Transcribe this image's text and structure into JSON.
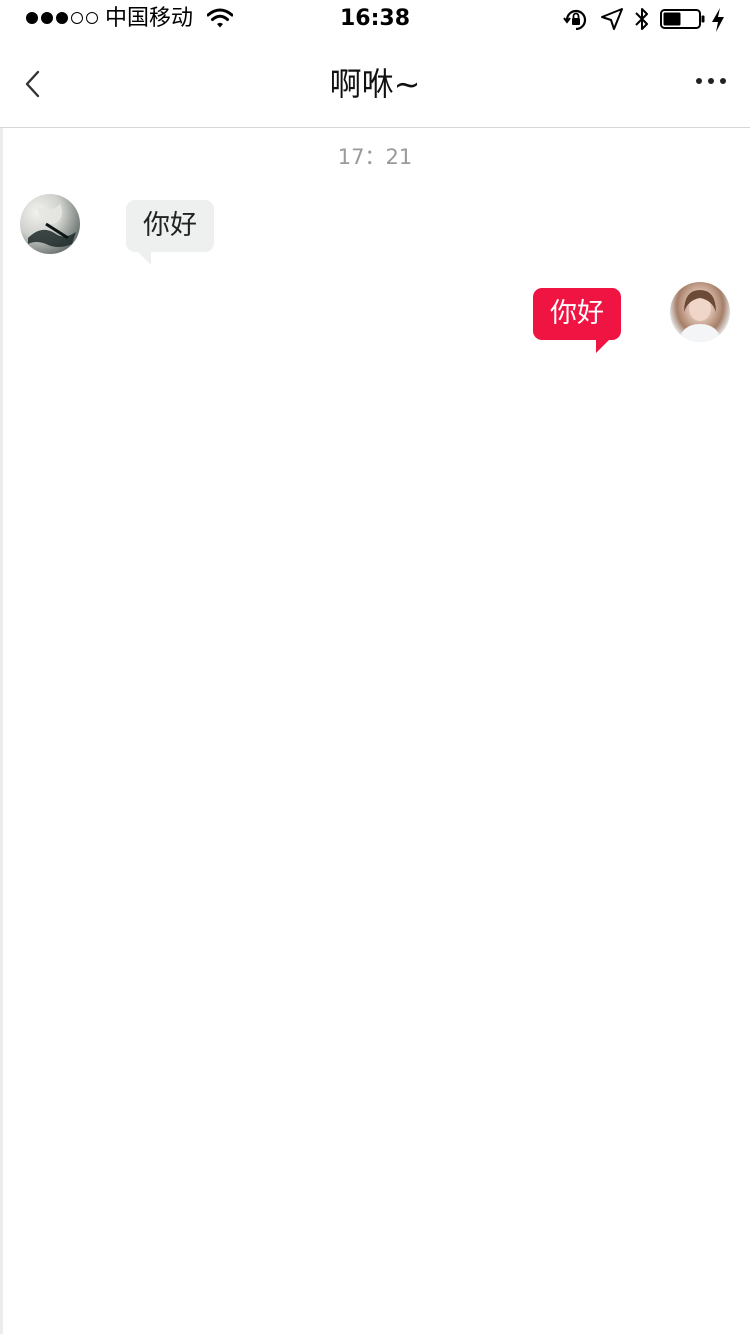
{
  "status_bar": {
    "signal_bars_filled": 3,
    "signal_bars_total": 5,
    "carrier": "中国移动",
    "time": "16:38",
    "battery_level": 0.5,
    "icons": [
      "wifi-icon",
      "rotation-lock-icon",
      "location-icon",
      "bluetooth-icon",
      "battery-icon",
      "charging-icon"
    ]
  },
  "nav": {
    "back_icon": "chevron-left-icon",
    "title": "啊咻~",
    "more_icon": "ellipsis-icon"
  },
  "chat": {
    "timestamp": "17：21",
    "messages": [
      {
        "sender": "peer",
        "text": "你好"
      },
      {
        "sender": "self",
        "text": "你好"
      }
    ]
  },
  "colors": {
    "self_bubble": "#f01443",
    "peer_bubble": "#eef0ef",
    "timestamp_text": "#9a9a9a",
    "divider": "#d6d6d6"
  }
}
